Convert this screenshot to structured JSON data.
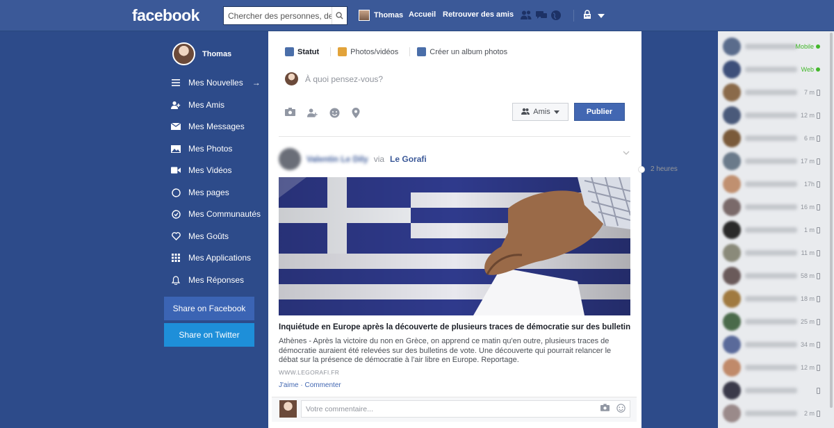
{
  "topbar": {
    "logo": "facebook",
    "search_placeholder": "Chercher des personnes, des lieux et d'autres choses",
    "user_name": "Thomas",
    "links": [
      "Accueil",
      "Retrouver des amis"
    ]
  },
  "sidebar": {
    "profile_name": "Thomas",
    "items": [
      {
        "label": "Mes Nouvelles",
        "icon": "menu-lines-icon",
        "suffix": "→"
      },
      {
        "label": "Mes Amis",
        "icon": "friends-icon"
      },
      {
        "label": "Mes Messages",
        "icon": "envelope-icon"
      },
      {
        "label": "Mes Photos",
        "icon": "photo-icon"
      },
      {
        "label": "Mes Vidéos",
        "icon": "video-camera-icon"
      },
      {
        "label": "Mes pages",
        "icon": "circle-icon"
      },
      {
        "label": "Mes Communautés",
        "icon": "check-circle-icon"
      },
      {
        "label": "Mes Goûts",
        "icon": "heart-icon"
      },
      {
        "label": "Mes Applications",
        "icon": "grid-icon"
      },
      {
        "label": "Mes Réponses",
        "icon": "bell-icon"
      }
    ],
    "share_facebook": "Share on Facebook",
    "share_twitter": "Share on Twitter"
  },
  "composer": {
    "tabs": [
      "Statut",
      "Photos/vidéos",
      "Créer un album photos"
    ],
    "placeholder": "À quoi pensez-vous?",
    "audience": "Amis",
    "publish": "Publier"
  },
  "post": {
    "author": "Valentin Le Dily",
    "via": "via",
    "source": "Le Gorafi",
    "time": "2 heures",
    "title": "Inquiétude en Europe après la découverte de plusieurs traces de démocratie sur des bulletins de...",
    "description": "Athènes - Après la victoire du non en Grèce, on apprend ce matin qu'en outre, plusieurs traces de démocratie auraient été relevées sur des bulletins de vote. Une découverte qui pourrait relancer le débat sur la présence de démocratie à l'air libre en Europe. Reportage.",
    "domain": "WWW.LEGORAFI.FR",
    "like": "J'aime",
    "separator": " · ",
    "comment": "Commenter",
    "comment_placeholder": "Votre commentaire..."
  },
  "chat": {
    "contacts": [
      {
        "status": "Mobile",
        "online": true,
        "color": "#5a6c8c"
      },
      {
        "status": "Web",
        "online": true,
        "color": "#3d4f7a"
      },
      {
        "status": "7 m",
        "online": false,
        "color": "#8a6a4a"
      },
      {
        "status": "12 m",
        "online": false,
        "color": "#4a5a7a"
      },
      {
        "status": "6 m",
        "online": false,
        "color": "#7a5a3a"
      },
      {
        "status": "17 m",
        "online": false,
        "color": "#6a7a8a"
      },
      {
        "status": "17h",
        "online": false,
        "color": "#c09070"
      },
      {
        "status": "16 m",
        "online": false,
        "color": "#7a6a6a"
      },
      {
        "status": "1 m",
        "online": false,
        "color": "#2a2a2a"
      },
      {
        "status": "11 m",
        "online": false,
        "color": "#8a8a7a"
      },
      {
        "status": "58 m",
        "online": false,
        "color": "#6a5a5a"
      },
      {
        "status": "18 m",
        "online": false,
        "color": "#a07a40"
      },
      {
        "status": "25 m",
        "online": false,
        "color": "#4a6a4a"
      },
      {
        "status": "34 m",
        "online": false,
        "color": "#5a6a9a"
      },
      {
        "status": "12 m",
        "online": false,
        "color": "#c08a6a"
      },
      {
        "status": "",
        "online": false,
        "color": "#3a3a4a"
      },
      {
        "status": "2 m",
        "online": false,
        "color": "#9a8a8a"
      }
    ]
  }
}
